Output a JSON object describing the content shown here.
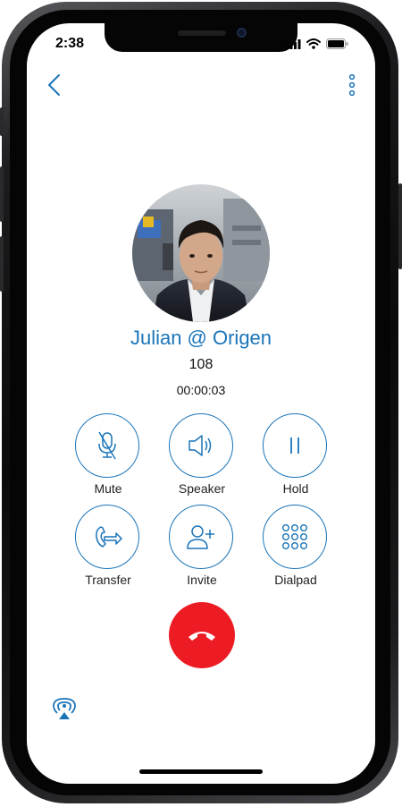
{
  "status_bar": {
    "time": "2:38",
    "icons": [
      "signal-icon",
      "wifi-icon",
      "battery-icon"
    ]
  },
  "toolbar": {
    "back_icon": "chevron-left-icon",
    "more_icon": "more-vertical-icon"
  },
  "caller": {
    "name": "Julian @ Origen",
    "extension": "108",
    "duration": "00:00:03"
  },
  "controls": [
    {
      "label": "Mute",
      "icon": "mic-off-icon"
    },
    {
      "label": "Speaker",
      "icon": "speaker-icon"
    },
    {
      "label": "Hold",
      "icon": "pause-icon"
    },
    {
      "label": "Transfer",
      "icon": "transfer-icon"
    },
    {
      "label": "Invite",
      "icon": "add-person-icon"
    },
    {
      "label": "Dialpad",
      "icon": "dialpad-icon"
    }
  ],
  "end_call": {
    "icon": "hangup-icon"
  },
  "bottom": {
    "icon": "airplay-icon"
  },
  "colors": {
    "accent": "#1a74b8",
    "hangup": "#ed1c24",
    "background": "#ffffff"
  }
}
